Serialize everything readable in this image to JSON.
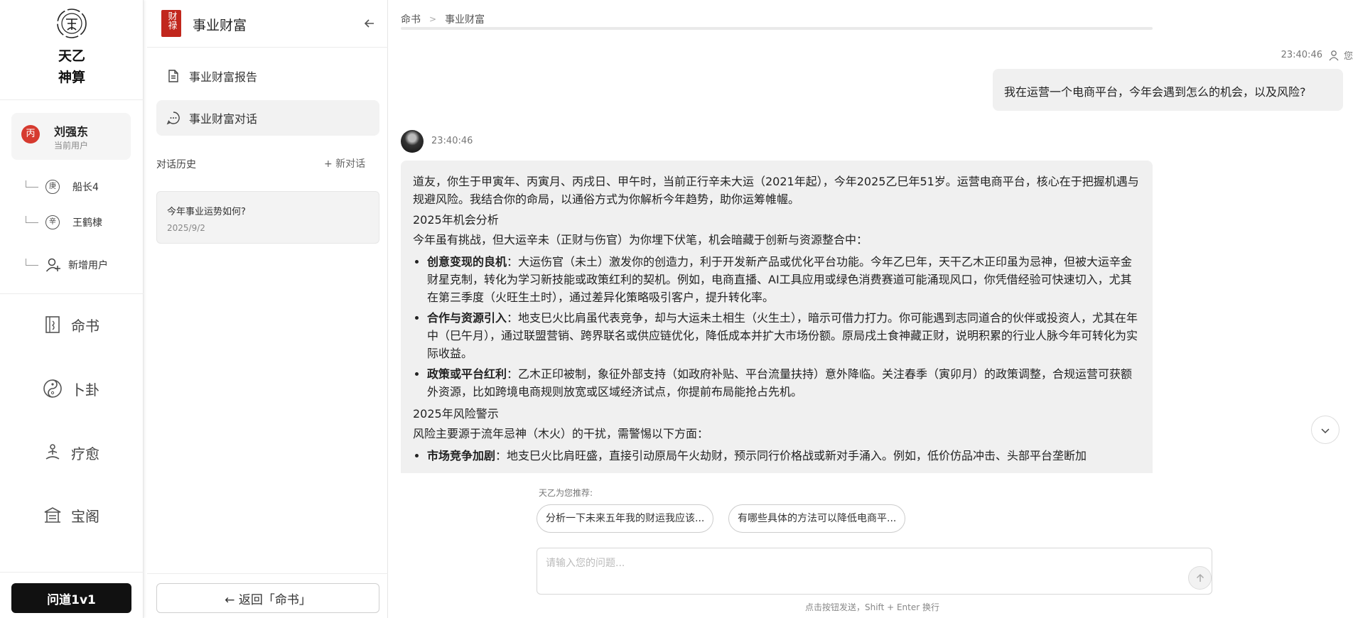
{
  "nav": {
    "logo_icon": "tianyi-seal-icon",
    "logo_line1": "天乙",
    "logo_line2": "神算",
    "current_user": {
      "avatar_char": "丙",
      "name": "刘强东",
      "sub": "当前用户"
    },
    "sub_users": [
      {
        "avatar_char": "庚",
        "name": "船长4"
      },
      {
        "avatar_char": "辛",
        "name": "王鹤棣"
      }
    ],
    "add_user_label": "新增用户",
    "menu": [
      {
        "label": "命书",
        "icon": "book-icon"
      },
      {
        "label": "卜卦",
        "icon": "yin-yang-icon"
      },
      {
        "label": "疗愈",
        "icon": "meditation-icon"
      },
      {
        "label": "宝阁",
        "icon": "pavilion-icon"
      }
    ],
    "ask_button": "问道1v1"
  },
  "panel": {
    "seal_text": "财禄",
    "title": "事业财富",
    "items": [
      {
        "label": "事业财富报告",
        "icon": "document-icon"
      },
      {
        "label": "事业财富对话",
        "icon": "chat-bubble-icon"
      }
    ],
    "history_label": "对话历史",
    "new_chat": "+  新对话",
    "history": [
      {
        "title": "今年事业运势如何?",
        "date": "2025/9/2"
      }
    ],
    "back_button": "←  返回「命书」"
  },
  "chat": {
    "breadcrumb": [
      "命书",
      "事业财富"
    ],
    "user_msg": {
      "time": "23:40:46",
      "who": "您",
      "text": "我在运营一个电商平台，今年会遇到怎么的机会，以及风险?"
    },
    "bot_msg": {
      "time": "23:40:46",
      "intro": "道友，你生于甲寅年、丙寅月、丙戌日、甲午时，当前正行辛未大运（2021年起），今年2025乙巳年51岁。运营电商平台，核心在于把握机遇与规避风险。我结合你的命局，以通俗方式为你解析今年趋势，助你运筹帷幄。",
      "sec1_title": "2025年机会分析",
      "sec1_lead": "今年虽有挑战，但大运辛未（正财与伤官）为你埋下伏笔，机会暗藏于创新与资源整合中：",
      "sec1_items": [
        {
          "b": "创意变现的良机",
          "t": "：大运伤官（未土）激发你的创造力，利于开发新产品或优化平台功能。今年乙巳年，天干乙木正印虽为忌神，但被大运辛金财星克制，转化为学习新技能或政策红利的契机。例如，电商直播、AI工具应用或绿色消费赛道可能涌现风口，你凭借经验可快速切入，尤其在第三季度（火旺生土时），通过差异化策略吸引客户，提升转化率。"
        },
        {
          "b": "合作与资源引入",
          "t": "：地支巳火比肩虽代表竞争，却与大运未土相生（火生土），暗示可借力打力。你可能遇到志同道合的伙伴或投资人，尤其在年中（巳午月），通过联盟营销、跨界联名或供应链优化，降低成本并扩大市场份额。原局戌土食神藏正财，说明积累的行业人脉今年可转化为实际收益。"
        },
        {
          "b": "政策或平台红利",
          "t": "：乙木正印被制，象征外部支持（如政府补贴、平台流量扶持）意外降临。关注春季（寅卯月）的政策调整，合规运营可获额外资源，比如跨境电商规则放宽或区域经济试点，你提前布局能抢占先机。"
        }
      ],
      "sec2_title": "2025年风险警示",
      "sec2_lead": "风险主要源于流年忌神（木火）的干扰，需警惕以下方面：",
      "sec2_items": [
        {
          "b": "市场竞争加剧",
          "t": "：地支巳火比肩旺盛，直接引动原局午火劫财，预示同行价格战或新对手涌入。例如，低价仿品冲击、头部平台垄断加"
        }
      ]
    },
    "recommend_label": "天乙为您推荐:",
    "recommendations": [
      "分析一下未来五年我的财运我应该...",
      "有哪些具体的方法可以降低电商平..."
    ],
    "input_placeholder": "请输入您的问题...",
    "hint": "点击按钮发送，Shift + Enter 换行"
  }
}
